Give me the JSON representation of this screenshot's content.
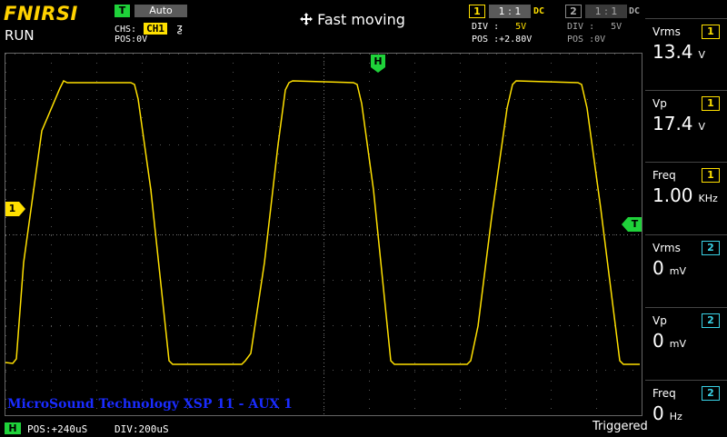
{
  "header": {
    "brand": "FNIRSI",
    "run_state": "RUN",
    "trigger_badge": "T",
    "trigger_mode": "Auto",
    "chs_label": "CHS:",
    "chs_value": "CH1",
    "edge_symbol": "ƺ",
    "pos_label": "POS:",
    "pos_value": "0V",
    "mode_icon": "move-arrows-icon",
    "mode_text": "Fast moving"
  },
  "ch1": {
    "badge": "1",
    "probe": "1 : 1",
    "coupling": "DC",
    "div_label": "DIV :",
    "div_value": "5V",
    "pos_label": "POS :",
    "pos_value": "+2.80V",
    "color": "#ffe000"
  },
  "ch2": {
    "badge": "2",
    "probe": "1 : 1",
    "coupling": "DC",
    "div_label": "DIV :",
    "div_value": "5V",
    "pos_label": "POS :",
    "pos_value": "0V"
  },
  "markers": {
    "h": "H",
    "ch1": "1",
    "trigger": "T"
  },
  "measurements": [
    {
      "label": "Vrms",
      "value": "13.4",
      "unit": "V",
      "channel": "1"
    },
    {
      "label": "Vp",
      "value": "17.4",
      "unit": "V",
      "channel": "1"
    },
    {
      "label": "Freq",
      "value": "1.00",
      "unit": "KHz",
      "channel": "1"
    },
    {
      "label": "Vrms",
      "value": "0",
      "unit": "mV",
      "channel": "2"
    },
    {
      "label": "Vp",
      "value": "0",
      "unit": "mV",
      "channel": "2"
    },
    {
      "label": "Freq",
      "value": "0",
      "unit": "Hz",
      "channel": "2"
    }
  ],
  "overlay_text": "MicroSound Technology XSP 11 - AUX 1",
  "footer": {
    "h_badge": "H",
    "pos_label": "POS:",
    "pos_value": "+240uS",
    "div_label": "DIV:",
    "div_value": "200uS",
    "status": "Triggered"
  },
  "colors": {
    "ch1": "#ffe000",
    "ch2": "#3ad2e6",
    "trigger": "#1fd23a",
    "brand": "#ffd200",
    "overlay": "#1a2cff"
  }
}
